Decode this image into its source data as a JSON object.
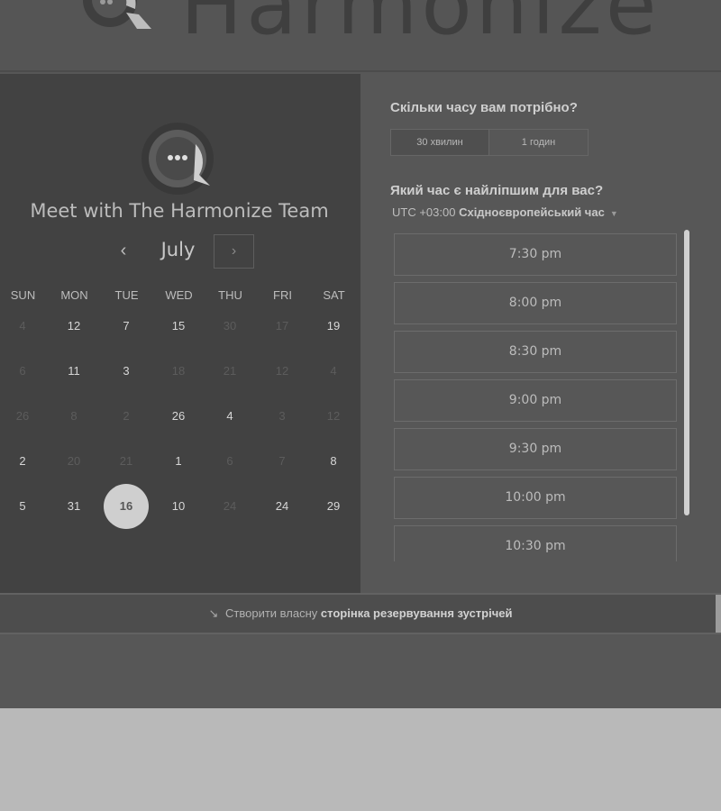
{
  "brand": {
    "name": "Harmonize",
    "logo_icon": "chat-bubble-logo-icon"
  },
  "calendar": {
    "title": "Meet with The Harmonize Team",
    "month": "July",
    "prev_glyph": "‹",
    "next_glyph": "›",
    "weekdays": [
      "SUN",
      "MON",
      "TUE",
      "WED",
      "THU",
      "FRI",
      "SAT"
    ],
    "weeks": [
      [
        {
          "d": "4",
          "a": false
        },
        {
          "d": "12",
          "a": true
        },
        {
          "d": "7",
          "a": true
        },
        {
          "d": "15",
          "a": true
        },
        {
          "d": "30",
          "a": false
        },
        {
          "d": "17",
          "a": false
        },
        {
          "d": "19",
          "a": true
        }
      ],
      [
        {
          "d": "6",
          "a": false
        },
        {
          "d": "11",
          "a": true
        },
        {
          "d": "3",
          "a": true
        },
        {
          "d": "18",
          "a": false
        },
        {
          "d": "21",
          "a": false
        },
        {
          "d": "12",
          "a": false
        },
        {
          "d": "4",
          "a": false
        }
      ],
      [
        {
          "d": "26",
          "a": false
        },
        {
          "d": "8",
          "a": false
        },
        {
          "d": "2",
          "a": false
        },
        {
          "d": "26",
          "a": true
        },
        {
          "d": "4",
          "a": true
        },
        {
          "d": "3",
          "a": false
        },
        {
          "d": "12",
          "a": false
        }
      ],
      [
        {
          "d": "2",
          "a": true
        },
        {
          "d": "20",
          "a": false
        },
        {
          "d": "21",
          "a": false
        },
        {
          "d": "1",
          "a": true
        },
        {
          "d": "6",
          "a": false
        },
        {
          "d": "7",
          "a": false
        },
        {
          "d": "8",
          "a": true
        }
      ],
      [
        {
          "d": "5",
          "a": true
        },
        {
          "d": "31",
          "a": true
        },
        {
          "d": "16",
          "a": true,
          "selected": true
        },
        {
          "d": "10",
          "a": true
        },
        {
          "d": "24",
          "a": false
        },
        {
          "d": "24",
          "a": true
        },
        {
          "d": "29",
          "a": true
        }
      ]
    ]
  },
  "booking": {
    "duration_question": "Скільки часу вам потрібно?",
    "durations": [
      "30 хвилин",
      "1 годин"
    ],
    "selected_duration": "30 хвилин",
    "time_question": "Який час є найліпшим для вас?",
    "timezone_offset": "UTC +03:00",
    "timezone_name": "Східноєвропейський час",
    "slots": [
      "7:30 pm",
      "8:00 pm",
      "8:30 pm",
      "9:00 pm",
      "9:30 pm",
      "10:00 pm",
      "10:30 pm"
    ]
  },
  "footer": {
    "prefix": "Створити власну",
    "link": "сторінка резервування зустрічей"
  }
}
